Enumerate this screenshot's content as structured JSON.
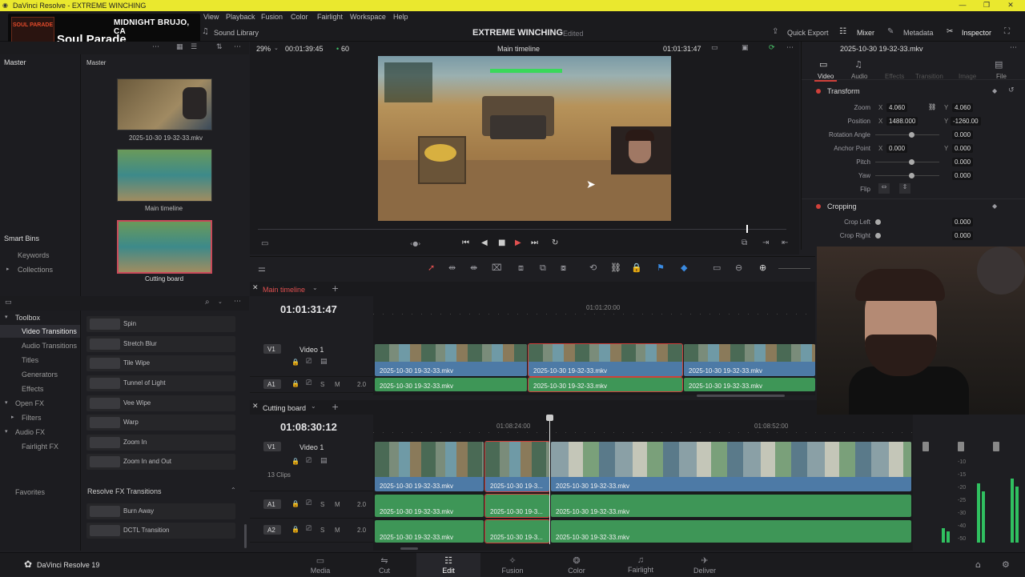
{
  "window": {
    "title": "DaVinci Resolve - EXTREME WINCHING"
  },
  "overlay": {
    "line1": "MIDNIGHT BRUJO, CA",
    "line2": "Soul Parade",
    "logo_text": "SOUL PARADE"
  },
  "menu": [
    "View",
    "Playback",
    "Fusion",
    "Color",
    "Fairlight",
    "Workspace",
    "Help"
  ],
  "toolbar": {
    "sound_library": "Sound Library",
    "project_name": "EXTREME WINCHING",
    "project_status": "Edited",
    "quick_export": "Quick Export",
    "mixer": "Mixer",
    "metadata": "Metadata",
    "inspector": "Inspector"
  },
  "media_pool": {
    "master": "Master",
    "folder": "Master",
    "smart_bins": "Smart Bins",
    "keywords": "Keywords",
    "collections": "Collections",
    "clips": [
      {
        "label": "2025-10-30 19-32-33.mkv"
      },
      {
        "label": "Main timeline"
      },
      {
        "label": "Cutting board"
      }
    ]
  },
  "viewer": {
    "zoom": "29%",
    "duration": "00:01:39:45",
    "fps": "60",
    "timeline_name": "Main timeline",
    "timecode": "01:01:31:47",
    "clip_name": "2025-10-30 19-32-33.mkv"
  },
  "inspector": {
    "tabs": [
      "Video",
      "Audio",
      "Effects",
      "Transition",
      "Image",
      "File"
    ],
    "transform": "Transform",
    "zoom": {
      "label": "Zoom",
      "x": "4.060",
      "y": "4.060"
    },
    "position": {
      "label": "Position",
      "x": "1488.000",
      "y": "-1260.00"
    },
    "rotation": {
      "label": "Rotation Angle",
      "v": "0.000"
    },
    "anchor": {
      "label": "Anchor Point",
      "x": "0.000",
      "y": "0.000"
    },
    "pitch": {
      "label": "Pitch",
      "v": "0.000"
    },
    "yaw": {
      "label": "Yaw",
      "v": "0.000"
    },
    "flip": {
      "label": "Flip"
    },
    "cropping": "Cropping",
    "crop_left": {
      "label": "Crop Left",
      "v": "0.000"
    },
    "crop_right": {
      "label": "Crop Right",
      "v": "0.000"
    }
  },
  "effects": {
    "toolbox": "Toolbox",
    "categories": [
      "Video Transitions",
      "Audio Transitions",
      "Titles",
      "Generators",
      "Effects",
      "Open FX",
      "Filters",
      "Audio FX",
      "Fairlight FX"
    ],
    "favorites": "Favorites",
    "items": [
      "Spin",
      "Stretch Blur",
      "Tile Wipe",
      "Tunnel of Light",
      "Vee Wipe",
      "Warp",
      "Zoom In",
      "Zoom In and Out"
    ],
    "resolve_fx_transitions": "Resolve FX Transitions",
    "fx_items": [
      "Burn Away",
      "DCTL Transition"
    ]
  },
  "main_timeline": {
    "tab": "Main timeline",
    "timecode": "01:01:31:47",
    "ruler": "01:01:20:00",
    "v1": "V1",
    "v1_name": "Video 1",
    "a1": "A1",
    "a1_level": "2.0",
    "clip": "2025-10-30 19-32-33.mkv"
  },
  "cutting_board": {
    "tab": "Cutting board",
    "timecode": "01:08:30:12",
    "ruler1": "01:08:24:00",
    "ruler2": "01:08:52:00",
    "v1": "V1",
    "v1_name": "Video 1",
    "clip_count": "13 Clips",
    "a1": "A1",
    "a2": "A2",
    "level": "2.0",
    "clip": "2025-10-30 19-32-33.mkv",
    "clip_short": "2025-10-30 19-3...",
    "meter_marks": [
      "-10",
      "-15",
      "-20",
      "-25",
      "-30",
      "-40",
      "-50"
    ]
  },
  "bottom": {
    "app": "DaVinci Resolve 19",
    "pages": [
      "Media",
      "Cut",
      "Edit",
      "Fusion",
      "Color",
      "Fairlight",
      "Deliver"
    ],
    "active": "Edit"
  },
  "colors": {
    "accent": "#d0403a",
    "video_clip": "#4d7aa6",
    "audio_clip": "#3e9657",
    "titlebar": "#eae82e"
  }
}
